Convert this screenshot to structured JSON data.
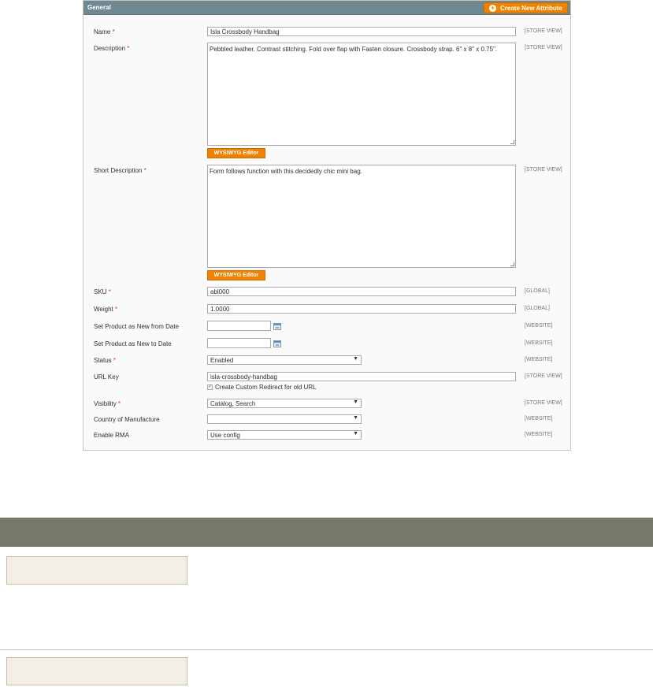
{
  "panel": {
    "title": "General",
    "create_button_label": "Create New Attribute"
  },
  "fields": {
    "name": {
      "label": "Name",
      "value": "Isla Crossbody Handbag",
      "scope": "[STORE VIEW]"
    },
    "description": {
      "label": "Description",
      "value": "Pebbled leather. Contrast stitching. Fold over flap with Fasten closure. Crossbody strap. 6\" x 8\" x 0.75\".",
      "scope": "[STORE VIEW]",
      "wysiwyg_label": "WYSIWYG Editor"
    },
    "short_description": {
      "label": "Short Description",
      "value": "Form follows function with this decidedly chic mini bag.",
      "scope": "[STORE VIEW]",
      "wysiwyg_label": "WYSIWYG Editor"
    },
    "sku": {
      "label": "SKU",
      "value": "abl000",
      "scope": "[GLOBAL]"
    },
    "weight": {
      "label": "Weight",
      "value": "1.0000",
      "scope": "[GLOBAL]"
    },
    "new_from": {
      "label": "Set Product as New from Date",
      "value": "",
      "scope": "[WEBSITE]"
    },
    "new_to": {
      "label": "Set Product as New to Date",
      "value": "",
      "scope": "[WEBSITE]"
    },
    "status": {
      "label": "Status",
      "value": "Enabled",
      "scope": "[WEBSITE]"
    },
    "url_key": {
      "label": "URL Key",
      "value": "isla-crossbody-handbag",
      "scope": "[STORE VIEW]",
      "redirect_label": "Create Custom Redirect for old URL",
      "redirect_checked": true
    },
    "visibility": {
      "label": "Visibility",
      "value": "Catalog, Search",
      "scope": "[STORE VIEW]"
    },
    "country": {
      "label": "Country of Manufacture",
      "value": "",
      "scope": "[WEBSITE]"
    },
    "rma": {
      "label": "Enable RMA",
      "value": "Use config",
      "scope": "[WEBSITE]"
    }
  },
  "required_marker": "*",
  "colors": {
    "header": "#6f8992",
    "accent_button": "#f18200",
    "required": "#eb340a",
    "table_header": "#78786a",
    "cell_fill": "#f4efe4"
  }
}
